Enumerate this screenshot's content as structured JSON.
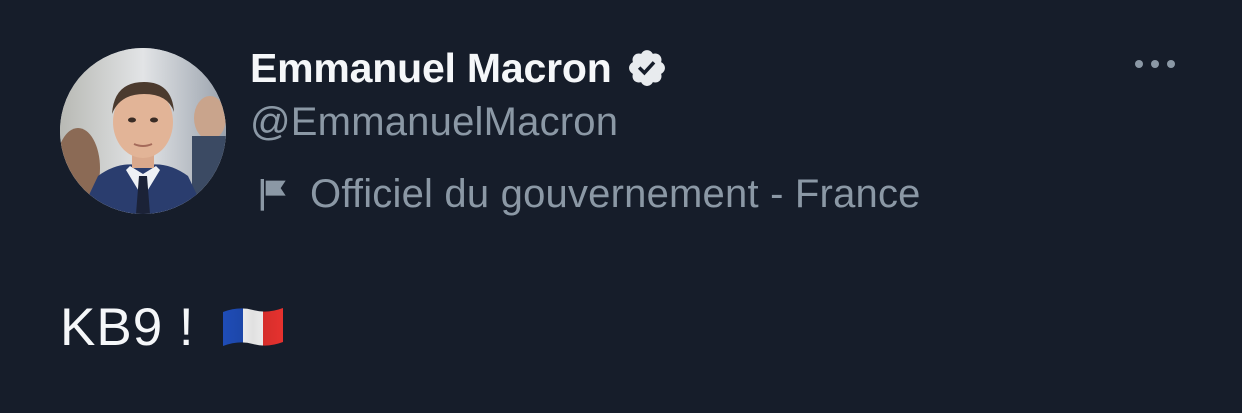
{
  "tweet": {
    "author": {
      "display_name": "Emmanuel Macron",
      "handle": "@EmmanuelMacron",
      "verified": true,
      "label": "Officiel du gouvernement - France"
    },
    "text": "KB9 !",
    "emoji": "flag-france",
    "more_icon": "more-horizontal-icon"
  },
  "colors": {
    "background": "#161d2a",
    "primary_text": "#f5f7f9",
    "secondary_text": "#8b98a5",
    "france_blue": "#1f4db8",
    "france_white": "#ffffff",
    "france_red": "#e8322f"
  }
}
